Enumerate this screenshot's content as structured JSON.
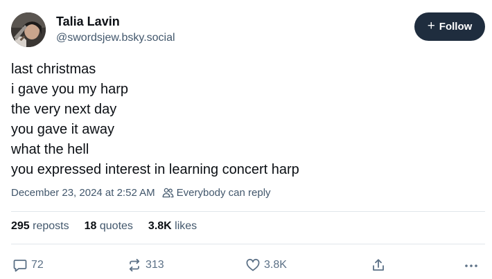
{
  "author": {
    "display_name": "Talia Lavin",
    "handle": "@swordsjew.bsky.social"
  },
  "follow_button": {
    "icon": "plus-icon",
    "label": "Follow"
  },
  "post": {
    "lines": [
      "last christmas",
      "i gave you my harp",
      "the very next day",
      "you gave it away",
      "what the hell",
      "you expressed interest in learning concert harp"
    ],
    "timestamp": "December 23, 2024 at 2:52 AM",
    "reply_setting": "Everybody can reply"
  },
  "stats": {
    "reposts_count": "295",
    "reposts_label": "reposts",
    "quotes_count": "18",
    "quotes_label": "quotes",
    "likes_count": "3.8K",
    "likes_label": "likes"
  },
  "actions": {
    "replies": "72",
    "reposts": "313",
    "likes": "3.8K"
  },
  "colors": {
    "text": "#0b0f14",
    "muted": "#42576c",
    "icon": "#5b7086",
    "follow_bg": "#1f2d3e",
    "divider": "#e1e6ea"
  }
}
